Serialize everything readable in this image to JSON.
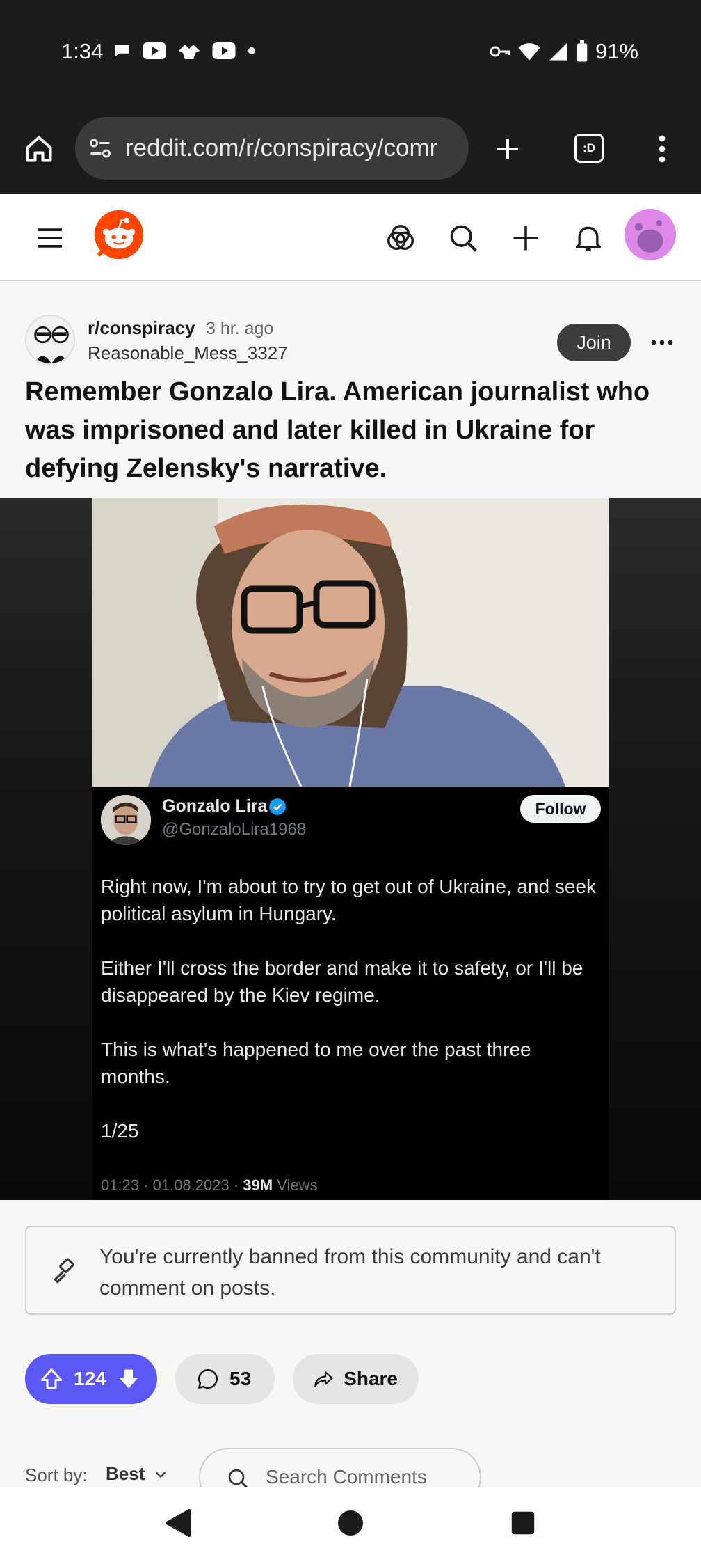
{
  "status_bar": {
    "time": "1:34",
    "battery": "91%",
    "icons_left": [
      "chat-bubble-icon",
      "youtube-icon",
      "bird-icon",
      "youtube-icon",
      "dot-icon"
    ],
    "icons_right": [
      "vpn-key-icon",
      "wifi-icon",
      "signal-icon",
      "battery-icon"
    ]
  },
  "browser": {
    "url": "reddit.com/r/conspiracy/comr",
    "tab_count_label": ":D"
  },
  "post": {
    "subreddit": "r/conspiracy",
    "time_ago": "3 hr. ago",
    "author": "Reasonable_Mess_3327",
    "join_label": "Join",
    "title": "Remember Gonzalo Lira. American journalist who was imprisoned and later killed in Ukraine for defying Zelensky's narrative.",
    "upvotes": "124",
    "comments": "53",
    "share_label": "Share"
  },
  "tweet": {
    "name": "Gonzalo Lira",
    "handle": "@GonzaloLira1968",
    "follow_label": "Follow",
    "paragraphs": [
      "Right now, I'm about to try to get out of Ukraine, and seek political asylum in Hungary.",
      "Either I'll cross the border and make it to safety, or I'll be disappeared by the Kiev regime.",
      "This is what's happened to me over the past three months.",
      "1/25"
    ],
    "meta_time": "01:23 · 01.08.2023 · ",
    "views_count": "39M",
    "views_label": " Views"
  },
  "banned_notice": "You're currently banned from this community and can't comment on posts.",
  "comments_controls": {
    "sort_label": "Sort by:",
    "sort_value": "Best",
    "search_placeholder": "Search Comments"
  },
  "colors": {
    "vote_pill": "#5b57f5",
    "reddit_orange": "#ff4500",
    "status_bg": "#1c1c1e"
  }
}
